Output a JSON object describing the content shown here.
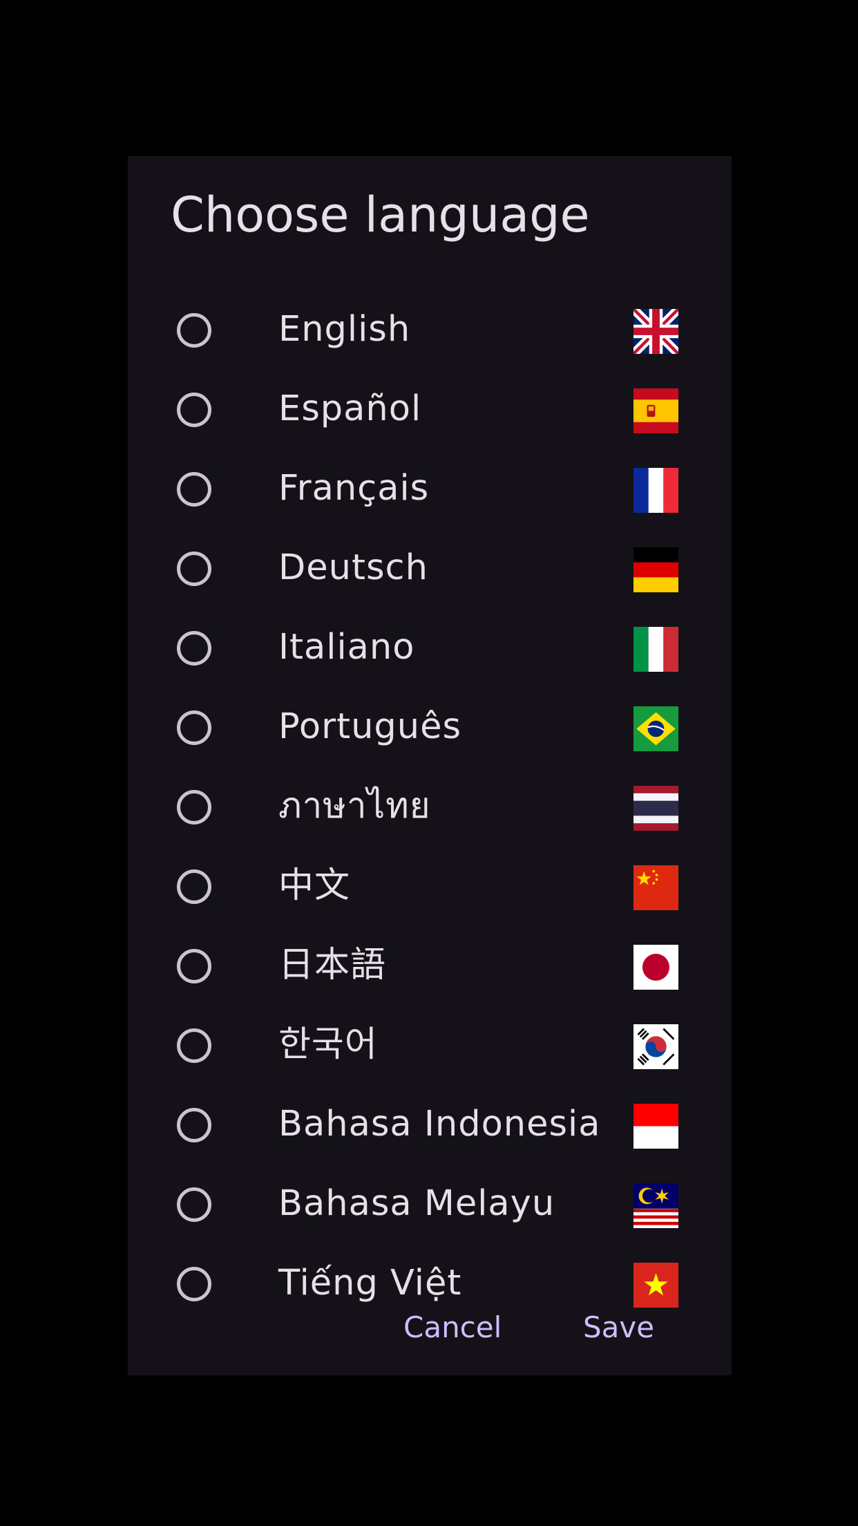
{
  "dialog": {
    "title": "Choose language",
    "languages": [
      {
        "label": "English",
        "flag": "uk-flag-icon"
      },
      {
        "label": "Español",
        "flag": "spain-flag-icon"
      },
      {
        "label": "Français",
        "flag": "france-flag-icon"
      },
      {
        "label": "Deutsch",
        "flag": "germany-flag-icon"
      },
      {
        "label": "Italiano",
        "flag": "italy-flag-icon"
      },
      {
        "label": "Português",
        "flag": "brazil-flag-icon"
      },
      {
        "label": "ภาษาไทย",
        "flag": "thailand-flag-icon"
      },
      {
        "label": "中文",
        "flag": "china-flag-icon"
      },
      {
        "label": "日本語",
        "flag": "japan-flag-icon"
      },
      {
        "label": "한국어",
        "flag": "korea-flag-icon"
      },
      {
        "label": "Bahasa Indonesia",
        "flag": "indonesia-flag-icon"
      },
      {
        "label": "Bahasa Melayu",
        "flag": "malaysia-flag-icon"
      },
      {
        "label": "Tiếng Việt",
        "flag": "vietnam-flag-icon"
      }
    ],
    "cancel_label": "Cancel",
    "save_label": "Save"
  },
  "colors": {
    "background": "#000000",
    "surface": "#141218",
    "on_surface": "#e6e0e9",
    "radio_outline": "#cac4d0",
    "primary": "#d0bcff"
  }
}
